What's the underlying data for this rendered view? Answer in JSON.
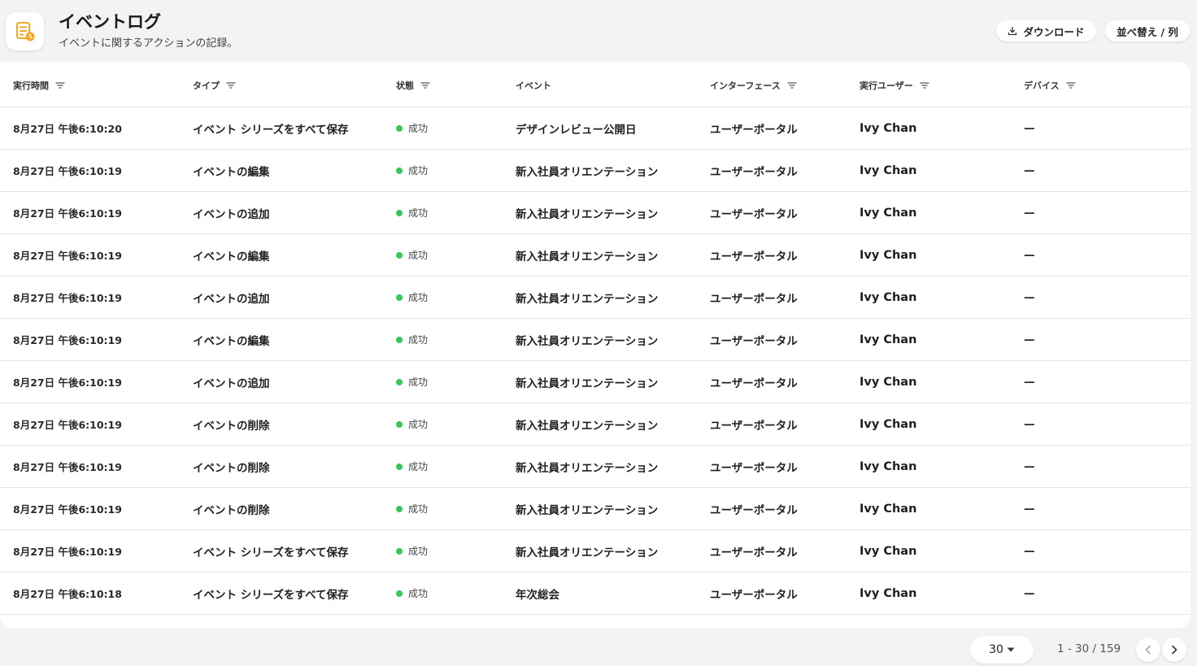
{
  "header": {
    "title": "イベントログ",
    "subtitle": "イベントに関するアクションの記録。",
    "download_label": "ダウンロード",
    "sort_label": "並べ替え / 列",
    "app_icon": "event-log-icon",
    "accent_color": "#f5a623"
  },
  "table": {
    "columns": [
      "実行時間",
      "タイプ",
      "状態",
      "イベント",
      "インターフェース",
      "実行ユーザー",
      "デバイス"
    ],
    "status_color": "#34c759",
    "rows": [
      {
        "time": "8月27日 午後6:10:20",
        "type": "イベント シリーズをすべて保存",
        "status": "成功",
        "event": "デザインレビュー公開日",
        "interface": "ユーザーポータル",
        "user": "Ivy Chan",
        "device": "—"
      },
      {
        "time": "8月27日 午後6:10:19",
        "type": "イベントの編集",
        "status": "成功",
        "event": "新入社員オリエンテーション",
        "interface": "ユーザーポータル",
        "user": "Ivy Chan",
        "device": "—"
      },
      {
        "time": "8月27日 午後6:10:19",
        "type": "イベントの追加",
        "status": "成功",
        "event": "新入社員オリエンテーション",
        "interface": "ユーザーポータル",
        "user": "Ivy Chan",
        "device": "—"
      },
      {
        "time": "8月27日 午後6:10:19",
        "type": "イベントの編集",
        "status": "成功",
        "event": "新入社員オリエンテーション",
        "interface": "ユーザーポータル",
        "user": "Ivy Chan",
        "device": "—"
      },
      {
        "time": "8月27日 午後6:10:19",
        "type": "イベントの追加",
        "status": "成功",
        "event": "新入社員オリエンテーション",
        "interface": "ユーザーポータル",
        "user": "Ivy Chan",
        "device": "—"
      },
      {
        "time": "8月27日 午後6:10:19",
        "type": "イベントの編集",
        "status": "成功",
        "event": "新入社員オリエンテーション",
        "interface": "ユーザーポータル",
        "user": "Ivy Chan",
        "device": "—"
      },
      {
        "time": "8月27日 午後6:10:19",
        "type": "イベントの追加",
        "status": "成功",
        "event": "新入社員オリエンテーション",
        "interface": "ユーザーポータル",
        "user": "Ivy Chan",
        "device": "—"
      },
      {
        "time": "8月27日 午後6:10:19",
        "type": "イベントの削除",
        "status": "成功",
        "event": "新入社員オリエンテーション",
        "interface": "ユーザーポータル",
        "user": "Ivy Chan",
        "device": "—"
      },
      {
        "time": "8月27日 午後6:10:19",
        "type": "イベントの削除",
        "status": "成功",
        "event": "新入社員オリエンテーション",
        "interface": "ユーザーポータル",
        "user": "Ivy Chan",
        "device": "—"
      },
      {
        "time": "8月27日 午後6:10:19",
        "type": "イベントの削除",
        "status": "成功",
        "event": "新入社員オリエンテーション",
        "interface": "ユーザーポータル",
        "user": "Ivy Chan",
        "device": "—"
      },
      {
        "time": "8月27日 午後6:10:19",
        "type": "イベント シリーズをすべて保存",
        "status": "成功",
        "event": "新入社員オリエンテーション",
        "interface": "ユーザーポータル",
        "user": "Ivy Chan",
        "device": "—"
      },
      {
        "time": "8月27日 午後6:10:18",
        "type": "イベント シリーズをすべて保存",
        "status": "成功",
        "event": "年次総会",
        "interface": "ユーザーポータル",
        "user": "Ivy Chan",
        "device": "—"
      }
    ]
  },
  "pagination": {
    "page_size": "30",
    "range_text": "1 - 30 / 159"
  }
}
